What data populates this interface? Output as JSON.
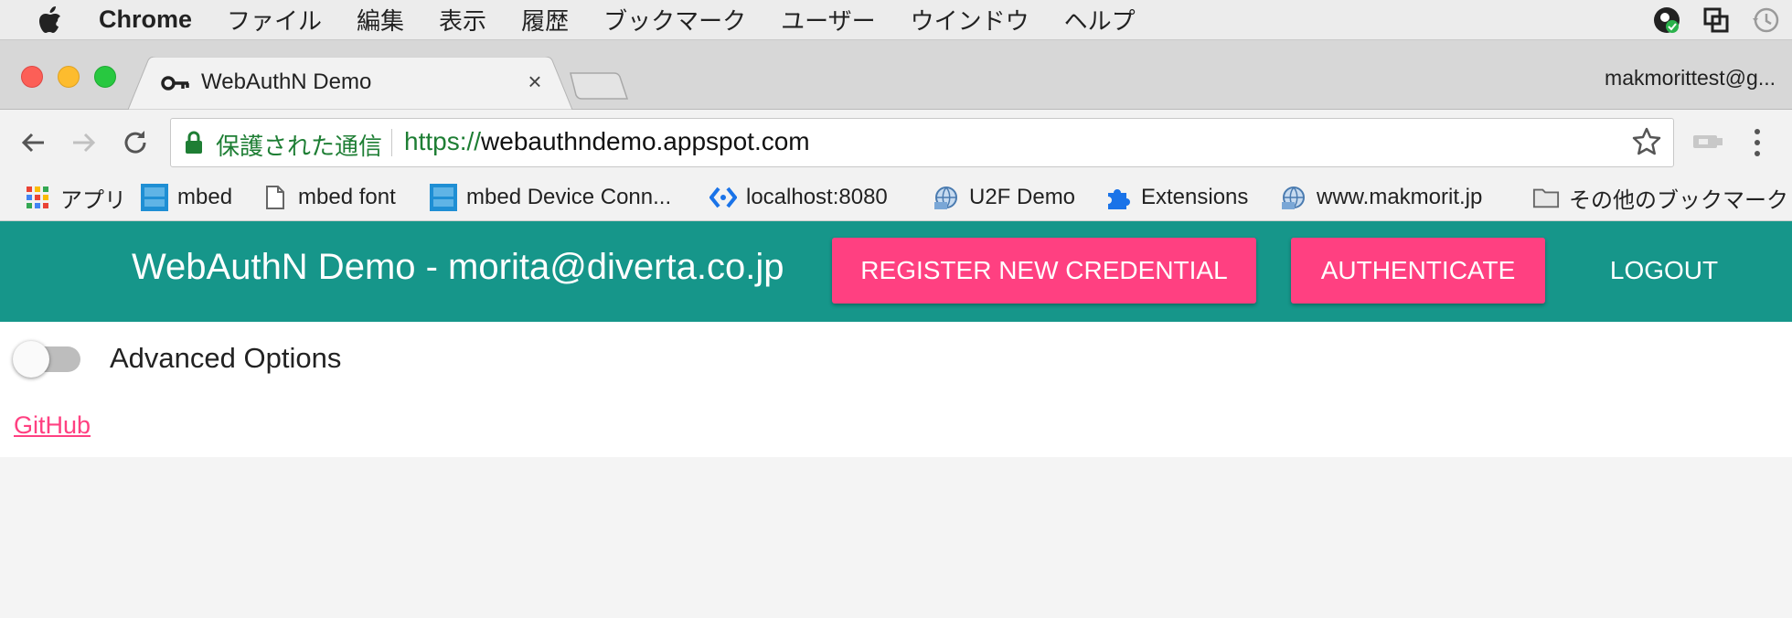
{
  "menubar": {
    "app_name": "Chrome",
    "items": [
      "ファイル",
      "編集",
      "表示",
      "履歴",
      "ブックマーク",
      "ユーザー",
      "ウインドウ",
      "ヘルプ"
    ]
  },
  "browser": {
    "tab_title": "WebAuthN Demo",
    "profile": "makmorittest@g...",
    "secure_label": "保護された通信",
    "url_scheme": "https://",
    "url_rest": "webauthndemo.appspot.com"
  },
  "bookmarks": [
    {
      "label": "アプリ",
      "icon": "apps-grid-icon"
    },
    {
      "label": "mbed",
      "icon": "arm-mbed-icon"
    },
    {
      "label": "mbed font",
      "icon": "page-icon"
    },
    {
      "label": "mbed Device Conn...",
      "icon": "arm-mbed-icon"
    },
    {
      "label": "localhost:8080",
      "icon": "code-icon"
    },
    {
      "label": "U2F Demo",
      "icon": "globe-icon"
    },
    {
      "label": "Extensions",
      "icon": "puzzle-icon"
    },
    {
      "label": "www.makmorit.jp",
      "icon": "globe-icon"
    },
    {
      "label": "その他のブックマーク",
      "icon": "folder-icon"
    }
  ],
  "app": {
    "title": "WebAuthN Demo - morita@diverta.co.jp",
    "register_label": "REGISTER NEW CREDENTIAL",
    "authenticate_label": "AUTHENTICATE",
    "logout_label": "LOGOUT",
    "advanced_label": "Advanced Options",
    "advanced_enabled": false,
    "github_label": "GitHub"
  },
  "colors": {
    "appbar": "#16968a",
    "accent": "#ff4081",
    "secure_green": "#1e7e34"
  }
}
